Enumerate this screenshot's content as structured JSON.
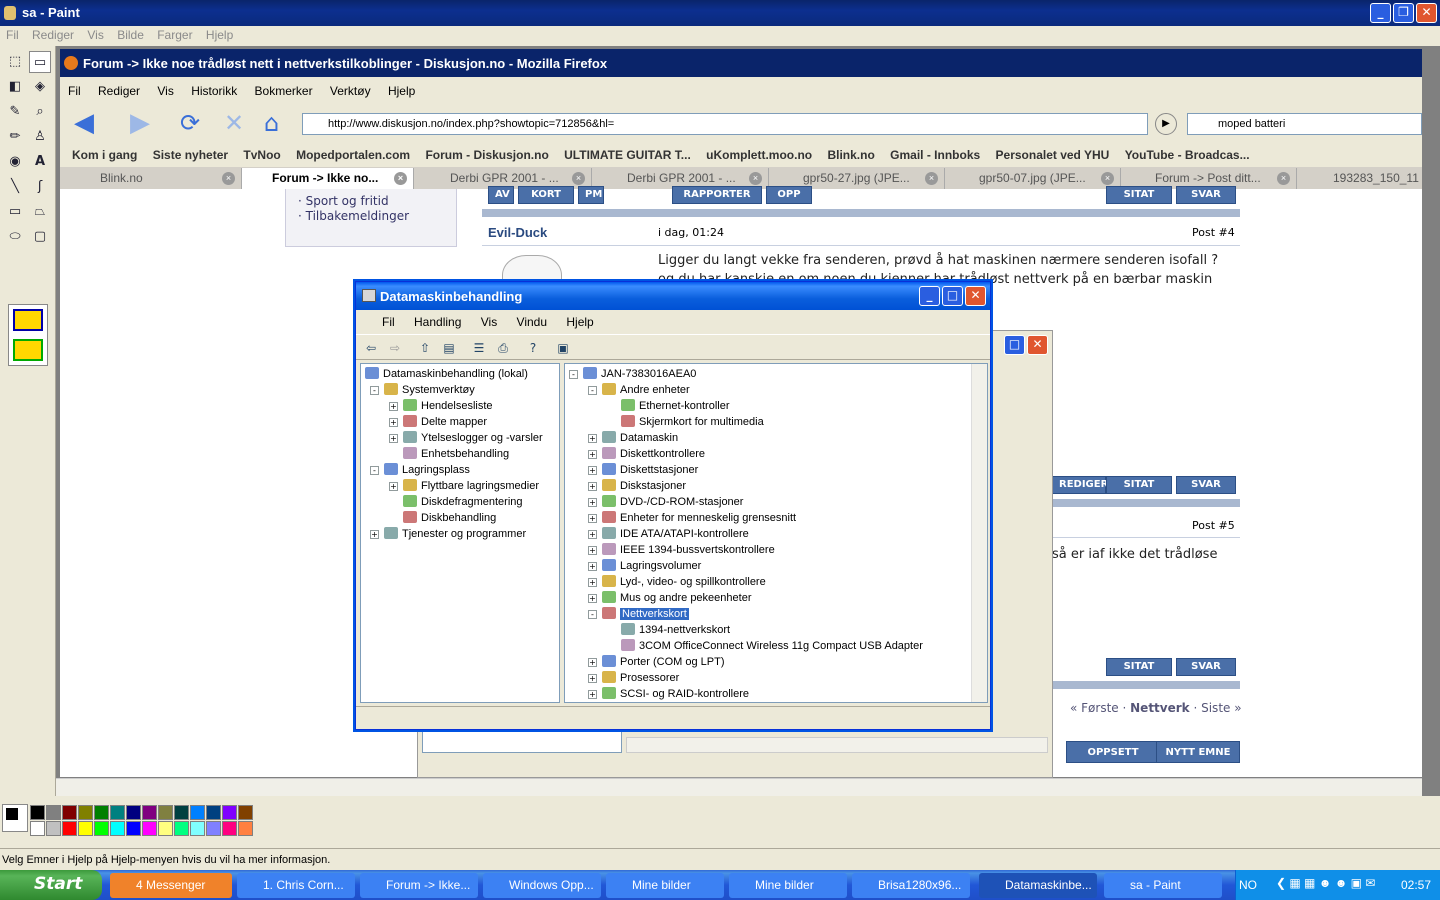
{
  "paint": {
    "title": "sa - Paint",
    "menu": [
      "Fil",
      "Rediger",
      "Vis",
      "Bilde",
      "Farger",
      "Hjelp"
    ],
    "status": "Velg Emner i Hjelp på Hjelp-menyen hvis du vil ha mer informasjon.",
    "palette": [
      "#000000",
      "#808080",
      "#800000",
      "#808000",
      "#008000",
      "#008080",
      "#000080",
      "#800080",
      "#808040",
      "#004040",
      "#0080ff",
      "#004080",
      "#8000ff",
      "#804000",
      "#ffffff",
      "#c0c0c0",
      "#ff0000",
      "#ffff00",
      "#00ff00",
      "#00ffff",
      "#0000ff",
      "#ff00ff",
      "#ffff80",
      "#00ff80",
      "#80ffff",
      "#8080ff",
      "#ff0080",
      "#ff8040"
    ]
  },
  "firefox": {
    "title": "Forum -> Ikke noe trådløst nett i nettverkstilkoblinger - Diskusjon.no - Mozilla Firefox",
    "menu": [
      "Fil",
      "Rediger",
      "Vis",
      "Historikk",
      "Bokmerker",
      "Verktøy",
      "Hjelp"
    ],
    "url": "http://www.diskusjon.no/index.php?showtopic=712856&hl=",
    "search": "moped batteri",
    "bookmarks": [
      "Kom i gang",
      "Siste nyheter",
      "TvNoo",
      "Mopedportalen.com",
      "Forum - Diskusjon.no",
      "ULTIMATE GUITAR T...",
      "uKomplett.moo.no",
      "Blink.no",
      "Gmail - Innboks",
      "Personalet ved YHU",
      "YouTube - Broadcas..."
    ],
    "tabs": [
      "Blink.no",
      "Forum -> Ikke no...",
      "Derbi GPR 2001 - ...",
      "Derbi GPR 2001 - ...",
      "gpr50-27.jpg (JPE...",
      "gpr50-07.jpg (JPE...",
      "Forum -> Post ditt...",
      "193283_150_11"
    ]
  },
  "forum": {
    "sidebar_links": [
      "Sport og fritid",
      "Tilbakemeldinger"
    ],
    "author": "Evil-Duck",
    "post_date": "i dag, 01:24",
    "post_num_4": "Post #4",
    "post_num_5": "Post #5",
    "post4_text": "Ligger du langt vekke fra senderen, prøvd å hat maskinen nærmere senderen isofall ? og du har kanskje en om noen du kjenner har trådløst nettverk på en bærbar maskin eller no, USB enheten din.",
    "post5_text": "så er iaf ikke det trådløse",
    "buttons": {
      "rediger": "REDIGER",
      "sitat": "SITAT",
      "svar": "SVAR",
      "oppsett": "OPPSETT",
      "nytt_emne": "NYTT EMNE",
      "rapporter": "RAPPORTER",
      "opp": "OPP",
      "kort": "KORT",
      "pm": "PM",
      "av": "AV"
    },
    "pager": {
      "forste": "« Første",
      "nettverk": "Nettverk",
      "siste": "Siste »"
    }
  },
  "dm": {
    "title": "Datamaskinbehandling",
    "menu": [
      "Fil",
      "Handling",
      "Vis",
      "Vindu",
      "Hjelp"
    ],
    "left_tree": [
      {
        "label": "Datamaskinbehandling (lokal)",
        "level": 0,
        "pm": ""
      },
      {
        "label": "Systemverktøy",
        "level": 1,
        "pm": "-"
      },
      {
        "label": "Hendelsesliste",
        "level": 2,
        "pm": "+"
      },
      {
        "label": "Delte mapper",
        "level": 2,
        "pm": "+"
      },
      {
        "label": "Ytelseslogger og -varsler",
        "level": 2,
        "pm": "+"
      },
      {
        "label": "Enhetsbehandling",
        "level": 2,
        "pm": ""
      },
      {
        "label": "Lagringsplass",
        "level": 1,
        "pm": "-"
      },
      {
        "label": "Flyttbare lagringsmedier",
        "level": 2,
        "pm": "+"
      },
      {
        "label": "Diskdefragmentering",
        "level": 2,
        "pm": ""
      },
      {
        "label": "Diskbehandling",
        "level": 2,
        "pm": ""
      },
      {
        "label": "Tjenester og programmer",
        "level": 1,
        "pm": "+"
      }
    ],
    "right_tree": [
      {
        "label": "JAN-7383016AEA0",
        "level": 0,
        "pm": "-"
      },
      {
        "label": "Andre enheter",
        "level": 1,
        "pm": "-"
      },
      {
        "label": "Ethernet-kontroller",
        "level": 2,
        "pm": ""
      },
      {
        "label": "Skjermkort for multimedia",
        "level": 2,
        "pm": ""
      },
      {
        "label": "Datamaskin",
        "level": 1,
        "pm": "+"
      },
      {
        "label": "Diskettkontrollere",
        "level": 1,
        "pm": "+"
      },
      {
        "label": "Diskettstasjoner",
        "level": 1,
        "pm": "+"
      },
      {
        "label": "Diskstasjoner",
        "level": 1,
        "pm": "+"
      },
      {
        "label": "DVD-/CD-ROM-stasjoner",
        "level": 1,
        "pm": "+"
      },
      {
        "label": "Enheter for menneskelig grensesnitt",
        "level": 1,
        "pm": "+"
      },
      {
        "label": "IDE ATA/ATAPI-kontrollere",
        "level": 1,
        "pm": "+"
      },
      {
        "label": "IEEE 1394-bussvertskontrollere",
        "level": 1,
        "pm": "+"
      },
      {
        "label": "Lagringsvolumer",
        "level": 1,
        "pm": "+"
      },
      {
        "label": "Lyd-, video- og spillkontrollere",
        "level": 1,
        "pm": "+"
      },
      {
        "label": "Mus og andre pekeenheter",
        "level": 1,
        "pm": "+"
      },
      {
        "label": "Nettverkskort",
        "level": 1,
        "pm": "-"
      },
      {
        "label": "1394-nettverkskort",
        "level": 2,
        "pm": ""
      },
      {
        "label": "3COM OfficeConnect Wireless 11g Compact USB Adapter",
        "level": 2,
        "pm": ""
      },
      {
        "label": "Porter (COM og LPT)",
        "level": 1,
        "pm": "+"
      },
      {
        "label": "Prosessorer",
        "level": 1,
        "pm": "+"
      },
      {
        "label": "SCSI- og RAID-kontrollere",
        "level": 1,
        "pm": "+"
      }
    ],
    "selected": "Nettverkskort"
  },
  "taskbar": {
    "start": "Start",
    "tasks": [
      "4 Messenger",
      "1. Chris Corn...",
      "Forum -> Ikke...",
      "Windows Opp...",
      "Mine bilder",
      "Mine bilder",
      "Brisa1280x96...",
      "Datamaskinbe...",
      "sa - Paint"
    ],
    "lang": "NO",
    "clock": "02:57"
  }
}
